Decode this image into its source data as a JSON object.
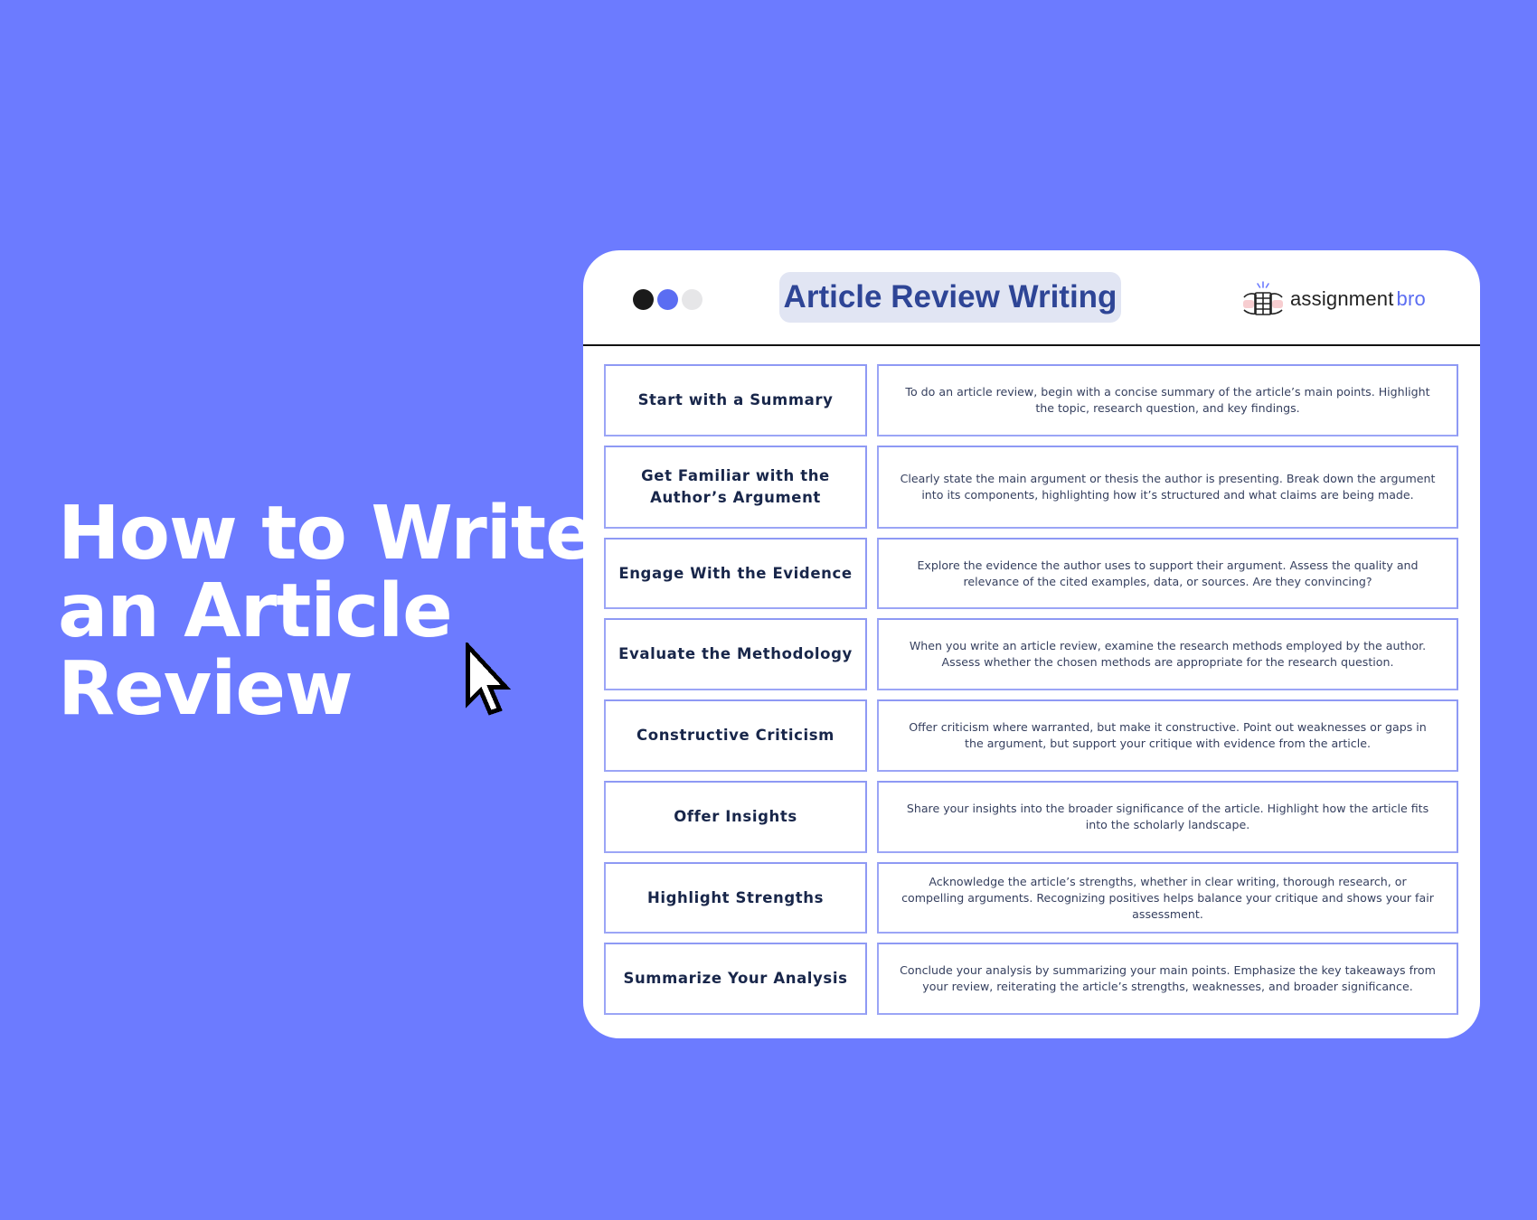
{
  "background_color": "#6c7bff",
  "hero": {
    "title_lines": [
      "How to Write",
      "an Article",
      "Review"
    ]
  },
  "card": {
    "window_dots": [
      "black",
      "blue",
      "grey"
    ],
    "title": "Article Review Writing",
    "logo": {
      "icon": "fist-bump-icon",
      "text_primary": "assignment",
      "text_accent": "bro",
      "accent_color": "#5b6df2"
    },
    "steps": [
      {
        "title": "Start with a Summary",
        "description": "To do an article review, begin with a concise summary of the article’s main points. Highlight the topic, research question, and key findings."
      },
      {
        "title": "Get Familiar with the Author’s Argument",
        "description": "Clearly state the main argument or thesis the author is presenting. Break down the argument into its components, highlighting how it’s structured and what claims are being made."
      },
      {
        "title": "Engage With the Evidence",
        "description": "Explore the evidence the author uses to support their argument. Assess the quality and relevance of the cited examples, data, or sources. Are they convincing?"
      },
      {
        "title": "Evaluate the Methodology",
        "description": "When you write an article review, examine the research methods employed by the author. Assess whether the chosen methods are appropriate for the research question."
      },
      {
        "title": "Constructive Criticism",
        "description": "Offer criticism where warranted, but make it constructive. Point out weaknesses or gaps in the argument, but support your critique with evidence from the article."
      },
      {
        "title": "Offer Insights",
        "description": "Share your insights into the broader significance of the article. Highlight how the article fits into the scholarly landscape."
      },
      {
        "title": "Highlight Strengths",
        "description": "Acknowledge the article’s strengths, whether in clear writing, thorough research, or compelling arguments. Recognizing positives helps balance your critique and shows your fair assessment."
      },
      {
        "title": "Summarize Your Analysis",
        "description": "Conclude your analysis by summarizing your main points. Emphasize the key takeaways from your review, reiterating the article’s strengths, weaknesses, and broader significance."
      }
    ]
  }
}
